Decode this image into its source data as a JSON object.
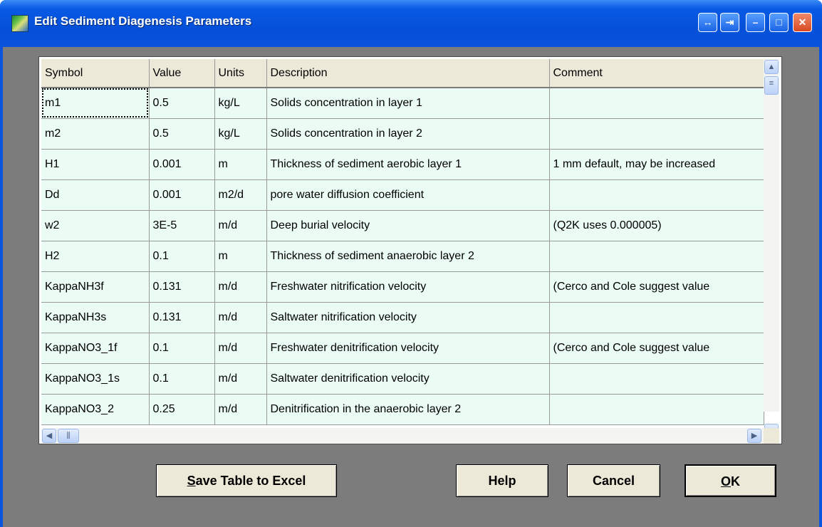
{
  "window": {
    "title": "Edit Sediment Diagenesis Parameters"
  },
  "table": {
    "columns": [
      "Symbol",
      "Value",
      "Units",
      "Description",
      "Comment"
    ],
    "rows": [
      [
        "m1",
        "0.5",
        "kg/L",
        "Solids concentration in layer 1",
        ""
      ],
      [
        "m2",
        "0.5",
        "kg/L",
        "Solids concentration in layer 2",
        ""
      ],
      [
        "H1",
        "0.001",
        "m",
        "Thickness of sediment aerobic layer 1",
        "1 mm default, may be increased"
      ],
      [
        "Dd",
        "0.001",
        "m2/d",
        "pore water diffusion coefficient",
        ""
      ],
      [
        "w2",
        "3E-5",
        "m/d",
        "Deep burial velocity",
        "(Q2K uses 0.000005)"
      ],
      [
        "H2",
        "0.1",
        "m",
        "Thickness of sediment anaerobic layer 2",
        ""
      ],
      [
        "KappaNH3f",
        "0.131",
        "m/d",
        "Freshwater nitrification velocity",
        "(Cerco and Cole suggest value"
      ],
      [
        "KappaNH3s",
        "0.131",
        "m/d",
        "Saltwater nitrification velocity",
        ""
      ],
      [
        "KappaNO3_1f",
        "0.1",
        "m/d",
        "Freshwater denitrification velocity",
        "(Cerco and Cole suggest value"
      ],
      [
        "KappaNO3_1s",
        "0.1",
        "m/d",
        "Saltwater denitrification velocity",
        ""
      ],
      [
        "KappaNO3_2",
        "0.25",
        "m/d",
        "Denitrification in the anaerobic layer 2",
        ""
      ]
    ]
  },
  "buttons": {
    "save_first": "S",
    "save_rest": "ave Table to Excel",
    "help": "Help",
    "cancel": "Cancel",
    "ok_first": "O",
    "ok_rest": "K"
  }
}
